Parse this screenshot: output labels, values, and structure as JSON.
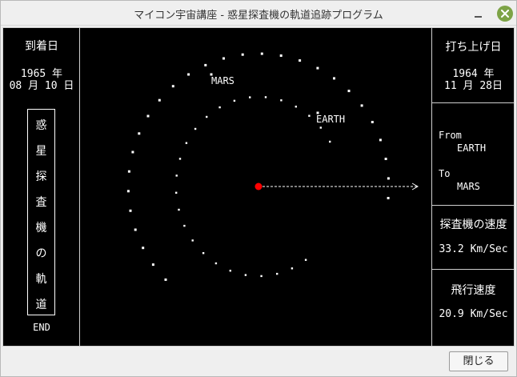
{
  "window": {
    "title": "マイコン宇宙講座 - 惑星探査機の軌道追跡プログラム",
    "close_button_label": "閉じる"
  },
  "left_panel": {
    "arrival_label": "到着日",
    "arrival_year": "1965 年",
    "arrival_date": "08 月 10 日",
    "vertical_title": [
      "惑",
      "星",
      "探",
      "査",
      "機",
      "の",
      "軌",
      "道"
    ],
    "end_label": "END"
  },
  "orbit": {
    "mars_label": "MARS",
    "earth_label": "EARTH",
    "sun_color": "#ff0000",
    "point_color": "#ffffff"
  },
  "right_panel": {
    "launch_label": "打ち上げ日",
    "launch_year": "1964 年",
    "launch_date": "11 月 28日",
    "from_label": "From",
    "from_value": "EARTH",
    "to_label": "To",
    "to_value": "MARS",
    "probe_speed_label": "探査機の速度",
    "probe_speed_value": "33.2 Km/Sec",
    "flight_speed_label": "飛行速度",
    "flight_speed_value": "20.9 Km/Sec"
  }
}
